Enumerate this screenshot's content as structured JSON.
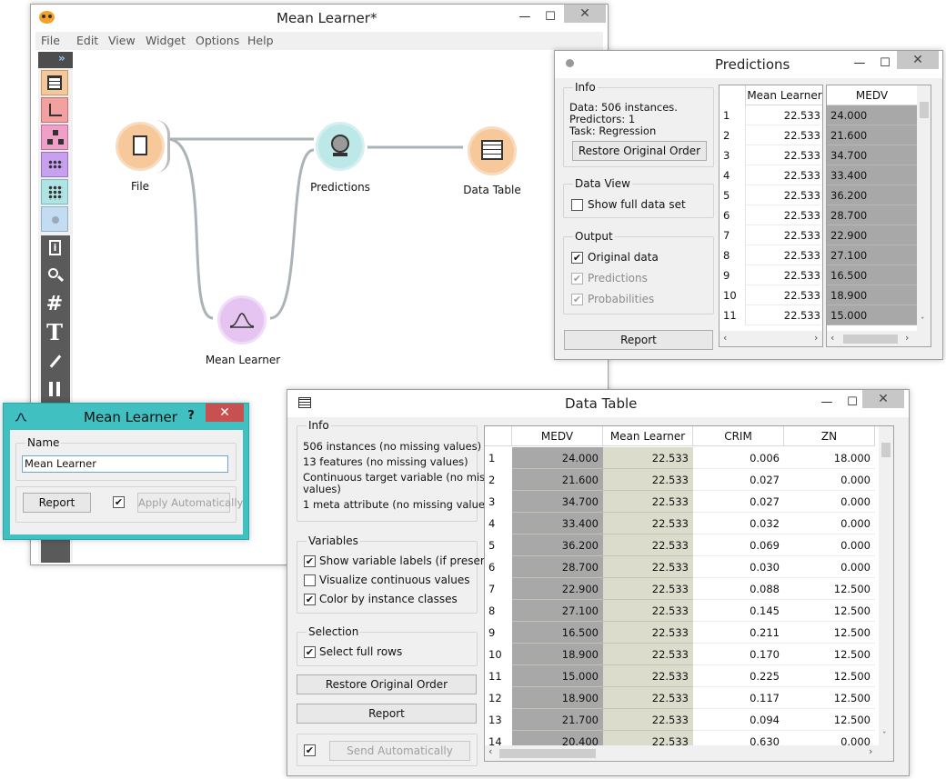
{
  "canvas_window": {
    "title": "Mean Learner*",
    "menu": [
      "File",
      "Edit",
      "View",
      "Widget",
      "Options",
      "Help"
    ],
    "minimize": "—",
    "maximize": "☐",
    "close": "✕",
    "toolbox_collapse": "»",
    "nodes": {
      "file": "File",
      "predictions": "Predictions",
      "data_table": "Data Table",
      "mean_learner": "Mean Learner"
    }
  },
  "predictions_window": {
    "title": "Predictions",
    "info_title": "Info",
    "info_lines": [
      "Data: 506 instances.",
      "Predictors: 1",
      "Task: Regression"
    ],
    "restore_btn": "Restore Original Order",
    "data_view_title": "Data View",
    "show_full": "Show full data set",
    "output_title": "Output",
    "out_original": "Original data",
    "out_predictions": "Predictions",
    "out_probabilities": "Probabilities",
    "report_btn": "Report",
    "col_pred": "Mean Learner",
    "col_target": "MEDV",
    "rows": [
      {
        "n": "1",
        "p": "22.533",
        "t": "24.000"
      },
      {
        "n": "2",
        "p": "22.533",
        "t": "21.600"
      },
      {
        "n": "3",
        "p": "22.533",
        "t": "34.700"
      },
      {
        "n": "4",
        "p": "22.533",
        "t": "33.400"
      },
      {
        "n": "5",
        "p": "22.533",
        "t": "36.200"
      },
      {
        "n": "6",
        "p": "22.533",
        "t": "28.700"
      },
      {
        "n": "7",
        "p": "22.533",
        "t": "22.900"
      },
      {
        "n": "8",
        "p": "22.533",
        "t": "27.100"
      },
      {
        "n": "9",
        "p": "22.533",
        "t": "16.500"
      },
      {
        "n": "10",
        "p": "22.533",
        "t": "18.900"
      },
      {
        "n": "11",
        "p": "22.533",
        "t": "15.000"
      }
    ]
  },
  "learner_window": {
    "title": "Mean Learner",
    "help": "?",
    "close": "✕",
    "name_title": "Name",
    "name_value": "Mean Learner",
    "report_btn": "Report",
    "apply_btn": "Apply Automatically"
  },
  "table_window": {
    "title": "Data Table",
    "info_title": "Info",
    "info_lines": [
      "506 instances (no missing values)",
      "13 features (no missing values)",
      "Continuous target variable (no missing",
      "values)",
      "1 meta attribute (no missing values)"
    ],
    "variables_title": "Variables",
    "show_labels": "Show variable labels (if present)",
    "visualize": "Visualize continuous values",
    "color_by": "Color by instance classes",
    "selection_title": "Selection",
    "select_rows": "Select full rows",
    "restore_btn": "Restore Original Order",
    "report_btn": "Report",
    "send_btn": "Send Automatically",
    "columns": [
      "MEDV",
      "Mean Learner",
      "CRIM",
      "ZN"
    ],
    "rows": [
      [
        "1",
        "24.000",
        "22.533",
        "0.006",
        "18.000"
      ],
      [
        "2",
        "21.600",
        "22.533",
        "0.027",
        "0.000"
      ],
      [
        "3",
        "34.700",
        "22.533",
        "0.027",
        "0.000"
      ],
      [
        "4",
        "33.400",
        "22.533",
        "0.032",
        "0.000"
      ],
      [
        "5",
        "36.200",
        "22.533",
        "0.069",
        "0.000"
      ],
      [
        "6",
        "28.700",
        "22.533",
        "0.030",
        "0.000"
      ],
      [
        "7",
        "22.900",
        "22.533",
        "0.088",
        "12.500"
      ],
      [
        "8",
        "27.100",
        "22.533",
        "0.145",
        "12.500"
      ],
      [
        "9",
        "16.500",
        "22.533",
        "0.211",
        "12.500"
      ],
      [
        "10",
        "18.900",
        "22.533",
        "0.170",
        "12.500"
      ],
      [
        "11",
        "15.000",
        "22.533",
        "0.225",
        "12.500"
      ],
      [
        "12",
        "18.900",
        "22.533",
        "0.117",
        "12.500"
      ],
      [
        "13",
        "21.700",
        "22.533",
        "0.094",
        "12.500"
      ],
      [
        "14",
        "20.400",
        "22.533",
        "0.630",
        "0.000"
      ]
    ]
  },
  "colors": {
    "file_node": "#f6c89a",
    "predictions_node": "#bde8e8",
    "table_node": "#f6c89a",
    "learner_node": "#e6c4f2",
    "target_col": "#a8a8a8",
    "pred_col": "#dcdccc",
    "accent": "#40c0c0"
  }
}
